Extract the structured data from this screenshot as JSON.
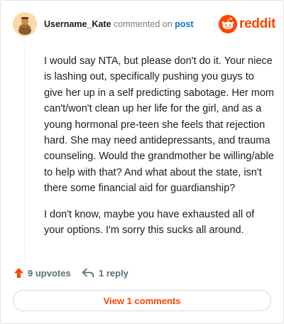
{
  "header": {
    "username": "Username_Kate",
    "action_text": "commented on",
    "post_link": "post",
    "logo_text": "reddit",
    "avatar_icon": "avatar-illustration-icon",
    "logo_icon": "reddit-snoo-icon"
  },
  "comment": {
    "paragraphs": [
      "I would say NTA, but please don't do it. Your niece is lashing out, specifically pushing you guys to give her up in a self predicting sabotage. Her mom can't/won't clean up her life for the girl, and as a young hormonal pre-teen she feels that rejection hard. She may need antidepressants, and trauma counseling. Would the grandmother be willing/able to help with that? And what about the state, isn't there some financial aid for guardianship?",
      "I don't know, maybe you have exhausted all of your options. I'm sorry this sucks all around."
    ]
  },
  "actions": {
    "upvotes_label": "9 upvotes",
    "reply_label": "1 reply",
    "upvote_icon": "upvote-arrow-icon",
    "reply_icon": "reply-arrow-icon"
  },
  "footer": {
    "view_comments_label": "View 1 comments"
  },
  "colors": {
    "brand": "#ff4500",
    "link": "#0079d3",
    "muted": "#7c7c7c"
  }
}
